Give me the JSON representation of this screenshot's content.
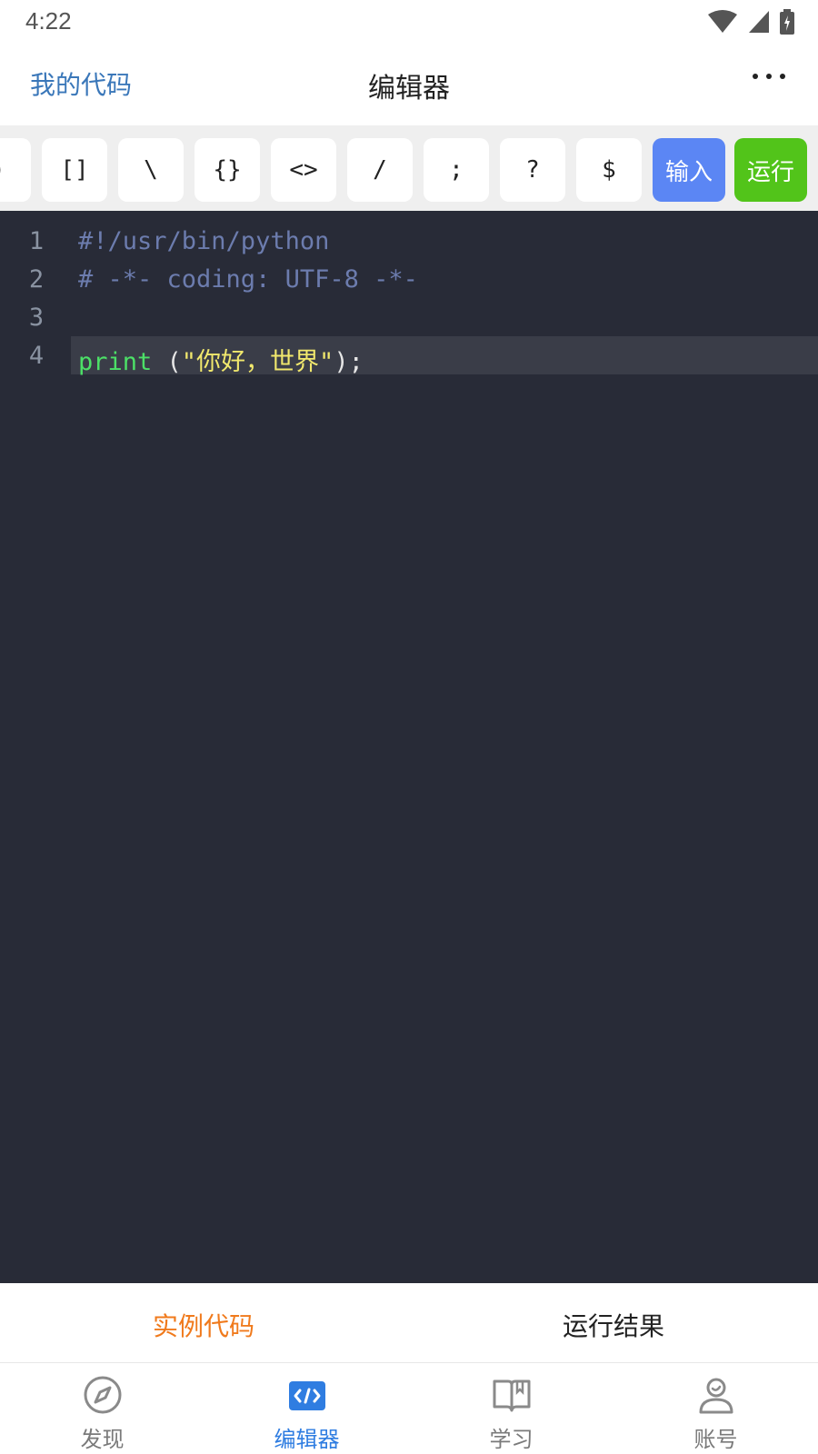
{
  "status_bar": {
    "time": "4:22"
  },
  "header": {
    "left_link": "我的代码",
    "title": "编辑器"
  },
  "toolbar": {
    "keys": [
      ")",
      "[]",
      "\\",
      "{}",
      "<>",
      "/",
      ";",
      "?",
      "$"
    ],
    "input_label": "输入",
    "run_label": "运行",
    "input_color": "#5b86f4",
    "run_color": "#52c41a"
  },
  "editor": {
    "line_numbers": [
      "1",
      "2",
      "3",
      "4"
    ],
    "lines": {
      "l1": "#!/usr/bin/python",
      "l2": "# -*- coding: UTF-8 -*-",
      "l4_kw": "print",
      "l4_open": " (",
      "l4_str": "\"你好，世界\"",
      "l4_close": ");"
    }
  },
  "result_tabs": {
    "example": "实例代码",
    "result": "运行结果",
    "active_color": "#f07a1c"
  },
  "nav": {
    "items": [
      {
        "label": "发现",
        "icon": "compass-icon"
      },
      {
        "label": "编辑器",
        "icon": "code-icon"
      },
      {
        "label": "学习",
        "icon": "book-icon"
      },
      {
        "label": "账号",
        "icon": "user-icon"
      }
    ],
    "active_color": "#2f7de1"
  }
}
